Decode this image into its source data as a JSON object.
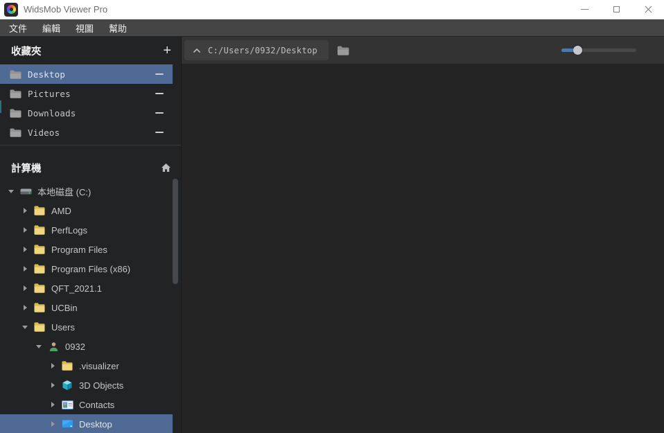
{
  "window": {
    "title": "WidsMob Viewer Pro"
  },
  "menu_bar": {
    "items": [
      {
        "id": "file",
        "label": "文件"
      },
      {
        "id": "edit",
        "label": "編輯"
      },
      {
        "id": "view",
        "label": "視圖"
      },
      {
        "id": "help",
        "label": "幫助"
      }
    ]
  },
  "sidebar": {
    "favorites": {
      "title": "收藏夾",
      "add_button": "+",
      "items": [
        {
          "id": "desktop",
          "label": "Desktop",
          "icon": "folder-gray",
          "selected": true
        },
        {
          "id": "pictures",
          "label": "Pictures",
          "icon": "folder-gray",
          "selected": false
        },
        {
          "id": "downloads",
          "label": "Downloads",
          "icon": "folder-gray",
          "selected": false
        },
        {
          "id": "videos",
          "label": "Videos",
          "icon": "folder-gray",
          "selected": false
        }
      ]
    },
    "computer": {
      "title": "計算機",
      "home_icon": "home-icon",
      "tree": [
        {
          "id": "c-drive",
          "label": "本地磁盘 (C:)",
          "icon": "drive",
          "level": 0,
          "state": "expanded",
          "selected": false
        },
        {
          "id": "amd",
          "label": "AMD",
          "icon": "folder-yellow",
          "level": 1,
          "state": "collapsed",
          "selected": false
        },
        {
          "id": "perflogs",
          "label": "PerfLogs",
          "icon": "folder-yellow",
          "level": 1,
          "state": "collapsed",
          "selected": false
        },
        {
          "id": "program-files",
          "label": "Program Files",
          "icon": "folder-yellow",
          "level": 1,
          "state": "collapsed",
          "selected": false
        },
        {
          "id": "program-files-x86",
          "label": "Program Files (x86)",
          "icon": "folder-yellow",
          "level": 1,
          "state": "collapsed",
          "selected": false
        },
        {
          "id": "qft-2021-1",
          "label": "QFT_2021.1",
          "icon": "folder-yellow",
          "level": 1,
          "state": "collapsed",
          "selected": false
        },
        {
          "id": "ucbin",
          "label": "UCBin",
          "icon": "folder-yellow",
          "level": 1,
          "state": "collapsed",
          "selected": false
        },
        {
          "id": "users",
          "label": "Users",
          "icon": "folder-yellow",
          "level": 1,
          "state": "expanded",
          "selected": false
        },
        {
          "id": "user-0932",
          "label": "0932",
          "icon": "user",
          "level": 2,
          "state": "expanded",
          "selected": false
        },
        {
          "id": "visualizer",
          "label": ".visualizer",
          "icon": "folder-yellow",
          "level": 3,
          "state": "collapsed",
          "selected": false
        },
        {
          "id": "3d-objects",
          "label": "3D Objects",
          "icon": "cube",
          "level": 3,
          "state": "collapsed",
          "selected": false
        },
        {
          "id": "contacts",
          "label": "Contacts",
          "icon": "contact",
          "level": 3,
          "state": "collapsed",
          "selected": false
        },
        {
          "id": "desktop",
          "label": "Desktop",
          "icon": "desktop",
          "level": 3,
          "state": "collapsed",
          "selected": true
        }
      ]
    }
  },
  "toolbar": {
    "path": "C:/Users/0932/Desktop",
    "up_icon": "chevron-up-icon",
    "folder_icon": "folder-icon",
    "zoom_slider": {
      "percent": 21
    }
  },
  "colors": {
    "selection": "#4f6a94",
    "folder_yellow": "#f0d67c",
    "slider_fill": "#4d7ba9",
    "titlebar_bg": "#ffffff",
    "menubar_bg": "#454545",
    "toolbar_bg": "#333334",
    "sidebar_bg": "#222324",
    "content_bg": "#242424"
  }
}
